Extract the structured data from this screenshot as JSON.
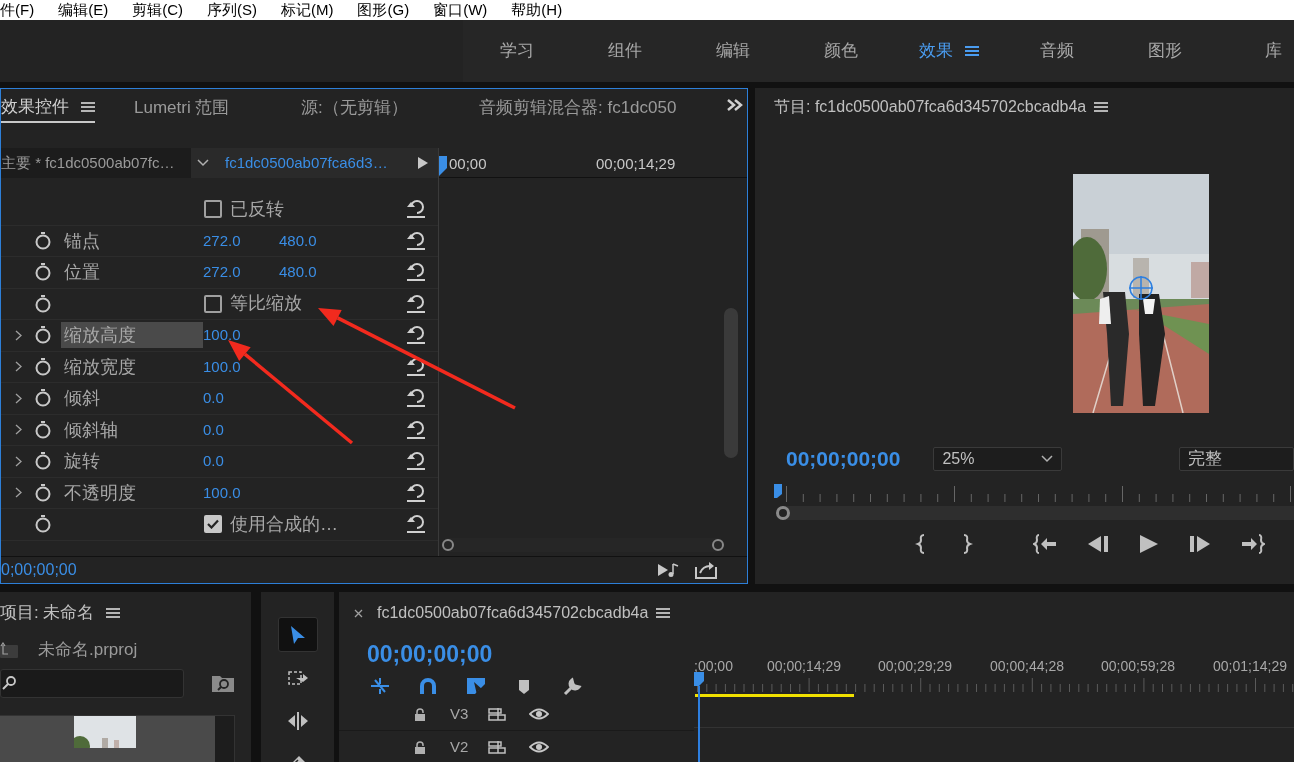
{
  "menu": [
    "件(F)",
    "编辑(E)",
    "剪辑(C)",
    "序列(S)",
    "标记(M)",
    "图形(G)",
    "窗口(W)",
    "帮助(H)"
  ],
  "workspaces": [
    {
      "label": "学习",
      "selected": false
    },
    {
      "label": "组件",
      "selected": false
    },
    {
      "label": "编辑",
      "selected": false
    },
    {
      "label": "颜色",
      "selected": false
    },
    {
      "label": "效果",
      "selected": true
    },
    {
      "label": "音频",
      "selected": false
    },
    {
      "label": "图形",
      "selected": false
    },
    {
      "label": "库",
      "selected": false
    }
  ],
  "effect_controls": {
    "tabs": [
      {
        "label": "效果控件",
        "selected": true
      },
      {
        "label": "Lumetri 范围",
        "selected": false
      },
      {
        "label": "源:（无剪辑）",
        "selected": false
      },
      {
        "label": "音频剪辑混合器: fc1dc050",
        "selected": false
      }
    ],
    "source_label": "主要 * fc1dc0500ab07fc…",
    "clip_label": "fc1dc0500ab07fca6d3…",
    "ruler_labels": [
      "00;00",
      "00;00;14;29"
    ],
    "properties": [
      {
        "kind": "checkbox",
        "label": "已反转",
        "checked": false,
        "stopwatch": false,
        "selected": false
      },
      {
        "kind": "value",
        "label": "锚点",
        "values": [
          "272.0",
          "480.0"
        ],
        "expandable": false,
        "selected": false
      },
      {
        "kind": "value",
        "label": "位置",
        "values": [
          "272.0",
          "480.0"
        ],
        "expandable": false,
        "selected": false
      },
      {
        "kind": "checkbox",
        "label": "等比缩放",
        "checked": false,
        "stopwatch": true,
        "selected": false
      },
      {
        "kind": "value",
        "label": "缩放高度",
        "values": [
          "100.0"
        ],
        "expandable": true,
        "selected": true
      },
      {
        "kind": "value",
        "label": "缩放宽度",
        "values": [
          "100.0"
        ],
        "expandable": true,
        "selected": false
      },
      {
        "kind": "value",
        "label": "倾斜",
        "values": [
          "0.0"
        ],
        "expandable": true,
        "selected": false
      },
      {
        "kind": "value",
        "label": "倾斜轴",
        "values": [
          "0.0"
        ],
        "expandable": true,
        "selected": false
      },
      {
        "kind": "value",
        "label": "旋转",
        "values": [
          "0.0"
        ],
        "expandable": true,
        "selected": false
      },
      {
        "kind": "value",
        "label": "不透明度",
        "values": [
          "100.0"
        ],
        "expandable": true,
        "selected": false
      },
      {
        "kind": "checkbox",
        "label": "使用合成的…",
        "checked": true,
        "stopwatch": true,
        "selected": false
      }
    ],
    "timecode": "0;00;00;00"
  },
  "program": {
    "title": "节目: fc1dc0500ab07fca6d345702cbcadb4a",
    "timecode": "00;00;00;00",
    "zoom": "25%",
    "quality": "完整"
  },
  "project": {
    "title": "项目: 未命名",
    "file": "未命名.prproj"
  },
  "tools": [
    {
      "kind": "select",
      "selected": true
    },
    {
      "kind": "track-select",
      "selected": false
    },
    {
      "kind": "ripple",
      "selected": false
    },
    {
      "kind": "razor",
      "selected": false
    }
  ],
  "timeline": {
    "title": "fc1dc0500ab07fca6d345702cbcadb4a",
    "timecode": "00;00;00;00",
    "ruler_labels": [
      ";00;00",
      "00;00;14;29",
      "00;00;29;29",
      "00;00;44;28",
      "00;00;59;28",
      "00;01;14;29"
    ],
    "tracks": [
      {
        "label": "V3"
      },
      {
        "label": "V2"
      }
    ]
  }
}
